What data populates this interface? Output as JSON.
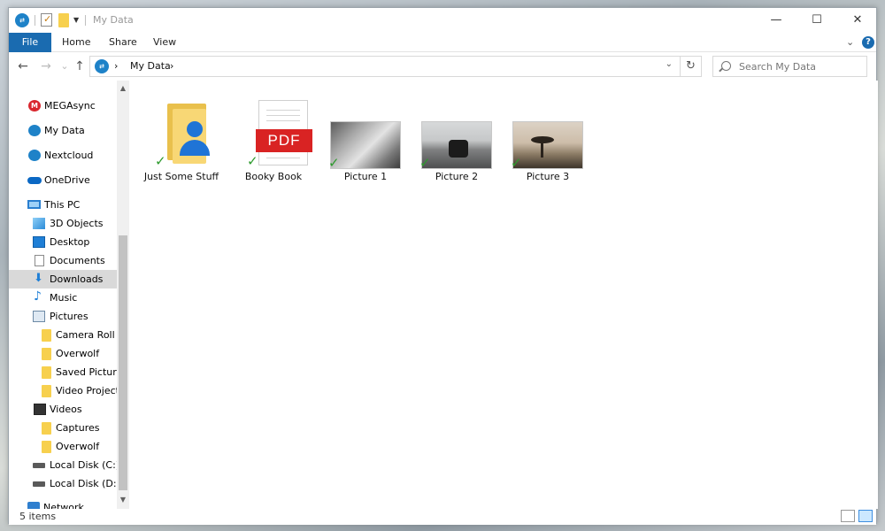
{
  "window": {
    "title": "My Data",
    "minimize": "—",
    "maximize": "☐",
    "close": "✕"
  },
  "ribbon": {
    "tabs": [
      "File",
      "Home",
      "Share",
      "View"
    ],
    "expand_glyph": "⌄",
    "help_glyph": "?"
  },
  "address": {
    "back": "←",
    "forward": "→",
    "recent": "⌄",
    "up": "↑",
    "separator": "›",
    "path": "My Data",
    "trail": "›",
    "dropdown": "⌄",
    "refresh": "↻",
    "search_placeholder": "Search My Data"
  },
  "sidebar": {
    "items": [
      {
        "label": "MEGAsync",
        "icon": "mega-icon"
      },
      {
        "label": "My Data",
        "icon": "cloud-sync-icon"
      },
      {
        "label": "Nextcloud",
        "icon": "nextcloud-icon"
      },
      {
        "label": "OneDrive",
        "icon": "onedrive-icon"
      },
      {
        "label": "This PC",
        "icon": "computer-icon"
      },
      {
        "label": "3D Objects",
        "icon": "cube-icon"
      },
      {
        "label": "Desktop",
        "icon": "desktop-icon"
      },
      {
        "label": "Documents",
        "icon": "document-icon"
      },
      {
        "label": "Downloads",
        "icon": "download-arrow-icon"
      },
      {
        "label": "Music",
        "icon": "music-note-icon"
      },
      {
        "label": "Pictures",
        "icon": "pictures-icon"
      },
      {
        "label": "Camera Roll",
        "icon": "folder-icon"
      },
      {
        "label": "Overwolf",
        "icon": "folder-icon"
      },
      {
        "label": "Saved Pictures",
        "icon": "folder-icon"
      },
      {
        "label": "Video Projects",
        "icon": "folder-icon"
      },
      {
        "label": "Videos",
        "icon": "video-icon"
      },
      {
        "label": "Captures",
        "icon": "folder-icon"
      },
      {
        "label": "Overwolf",
        "icon": "folder-icon"
      },
      {
        "label": "Local Disk (C:)",
        "icon": "drive-icon"
      },
      {
        "label": "Local Disk (D:)",
        "icon": "drive-icon"
      },
      {
        "label": "Network",
        "icon": "network-icon"
      }
    ],
    "mega_glyph": "M",
    "music_glyph": "♪",
    "down_glyph": "⬇",
    "scroll_up": "▲",
    "scroll_down": "▼"
  },
  "files": [
    {
      "name": "Just Some Stuff",
      "type": "folder",
      "sync_status": "synced"
    },
    {
      "name": "Booky Book",
      "type": "pdf",
      "badge": "PDF",
      "sync_status": "synced"
    },
    {
      "name": "Picture 1",
      "type": "image",
      "sync_status": "synced"
    },
    {
      "name": "Picture 2",
      "type": "image",
      "sync_status": "synced"
    },
    {
      "name": "Picture 3",
      "type": "image",
      "sync_status": "synced"
    }
  ],
  "check_glyph": "✓",
  "status": {
    "item_count": "5 items",
    "selected_view": "large-icons"
  },
  "colors": {
    "accent": "#1a6bb0",
    "sync_check": "#2d9a2d",
    "selected_nav": "#d9d9d9"
  }
}
